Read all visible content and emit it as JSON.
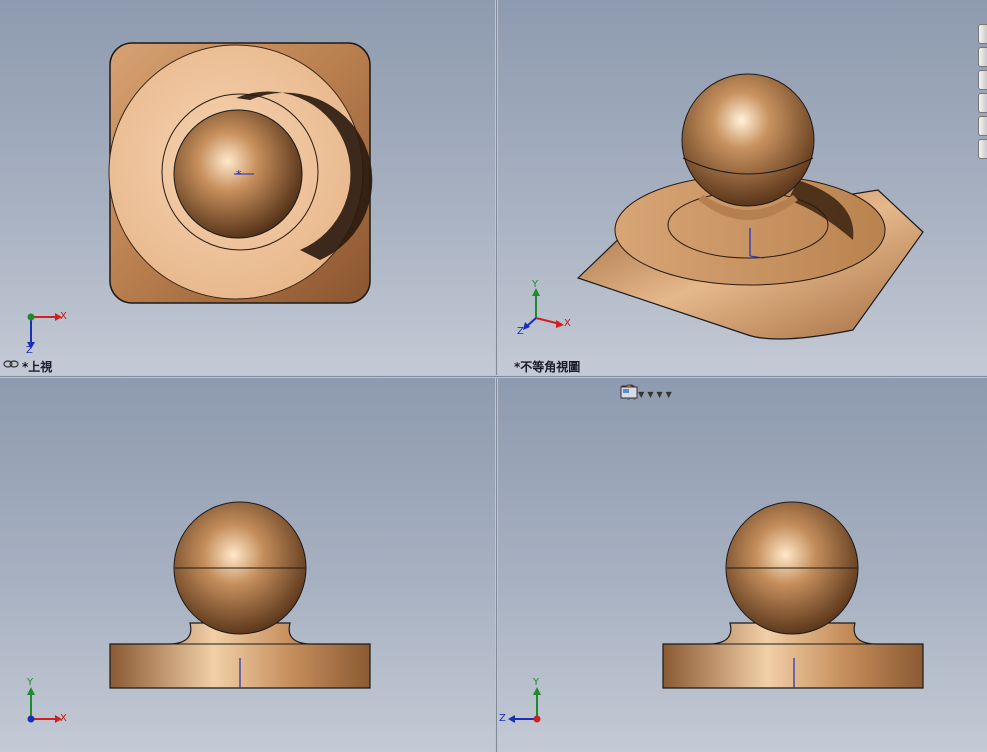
{
  "views": {
    "top": {
      "label": "*上視"
    },
    "isometric": {
      "label": "*不等角視圖"
    }
  },
  "triad": {
    "x": "X",
    "y": "Y",
    "z": "Z"
  },
  "heads_up_toolbar": {
    "icons": [
      "zoom-to-fit-icon",
      "zoom-area-icon",
      "previous-view-icon",
      "section-view-icon",
      "view-orientation-icon",
      "display-style-icon",
      "hide-show-items-icon",
      "edit-appearance-icon",
      "apply-scene-icon",
      "view-settings-icon"
    ]
  },
  "colors": {
    "viewport_top": "#8e9aaf",
    "viewport_bottom": "#c4cad5",
    "part_light": "#f3d2b0",
    "part_mid": "#c88f5e",
    "part_dark": "#5a3418",
    "axis_x": "#d02020",
    "axis_y": "#1f8a2c",
    "axis_z": "#1a2fb8"
  },
  "side_tabs_count": 6
}
